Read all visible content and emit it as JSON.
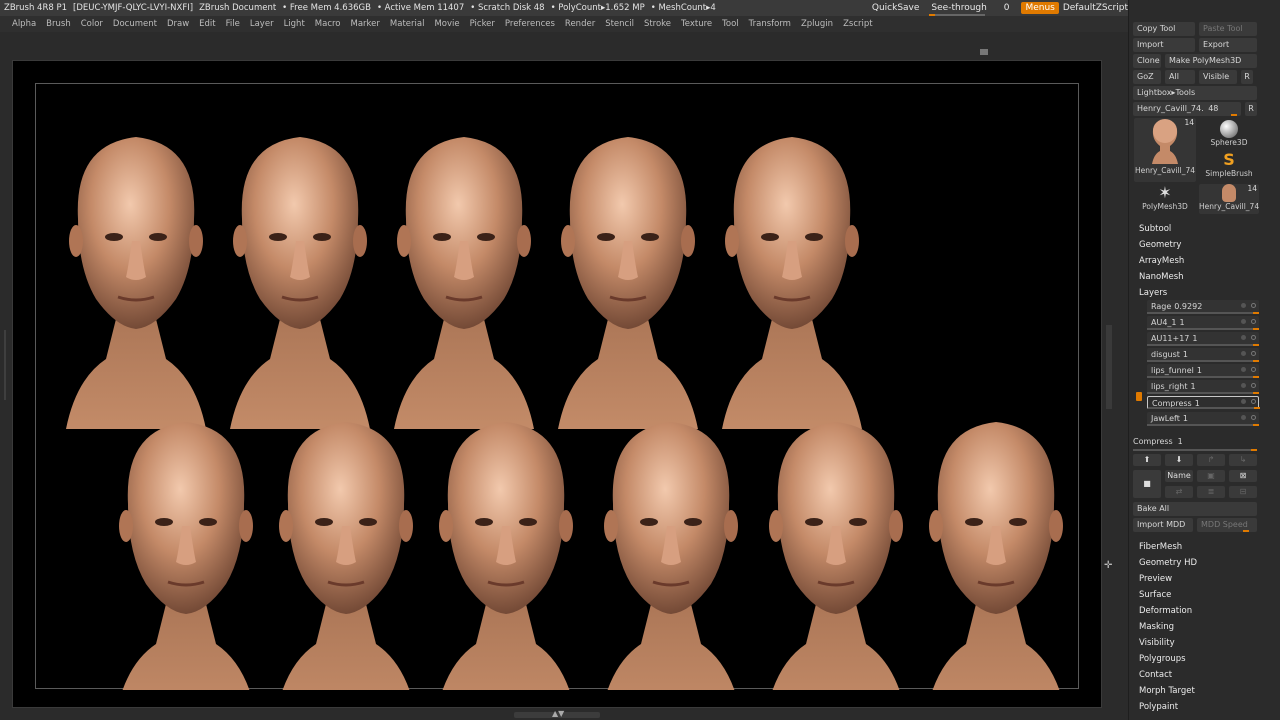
{
  "titlebar": {
    "app": "ZBrush 4R8 P1",
    "license": "[DEUC-YMJF-QLYC-LVYI-NXFI]",
    "document": "ZBrush Document",
    "free_mem": "• Free Mem 4.636GB",
    "active_mem": "• Active Mem 11407",
    "scratch": "• Scratch Disk 48",
    "polycount": "• PolyCount▸1.652 MP",
    "meshcount": "• MeshCount▸4",
    "quicksave": "QuickSave",
    "seethrough": "See-through",
    "seethrough_value": "0",
    "seethrough_level": 0.0,
    "menus": "Menus",
    "script": "DefaultZScript"
  },
  "menubar": {
    "items": [
      "Alpha",
      "Brush",
      "Color",
      "Document",
      "Draw",
      "Edit",
      "File",
      "Layer",
      "Light",
      "Macro",
      "Marker",
      "Material",
      "Movie",
      "Picker",
      "Preferences",
      "Render",
      "Stencil",
      "Stroke",
      "Texture",
      "Tool",
      "Transform",
      "Zplugin",
      "Zscript"
    ]
  },
  "tool_panel": {
    "copy_tool": "Copy Tool",
    "paste_tool": "Paste Tool",
    "import": "Import",
    "export": "Export",
    "clone": "Clone",
    "make_polymesh": "Make PolyMesh3D",
    "goz": "GoZ",
    "all": "All",
    "visible": "Visible",
    "r": "R",
    "lightbox": "Lightbox▸Tools",
    "current_tool": "Henry_Cavill_74.",
    "current_tool_value": "48",
    "tiles": [
      {
        "label": "Henry_Cavill_74",
        "count": "14"
      },
      {
        "label": "Sphere3D",
        "count": ""
      },
      {
        "label": "SimpleBrush",
        "count": ""
      },
      {
        "label": "PolyMesh3D",
        "count": ""
      },
      {
        "label": "Henry_Cavill_74",
        "count": "14"
      }
    ]
  },
  "sections_top": [
    "Subtool",
    "Geometry",
    "ArrayMesh",
    "NanoMesh"
  ],
  "layers": {
    "title": "Layers",
    "rows": [
      {
        "label": "Rage",
        "value": "0.9292"
      },
      {
        "label": "AU4_1",
        "value": "1"
      },
      {
        "label": "AU11+17",
        "value": "1"
      },
      {
        "label": "disgust",
        "value": "1"
      },
      {
        "label": "lips_funnel",
        "value": "1"
      },
      {
        "label": "lips_right",
        "value": "1"
      },
      {
        "label": "Compress",
        "value": "1"
      },
      {
        "label": "JawLeft",
        "value": "1"
      }
    ],
    "slider_label": "Compress",
    "slider_value": "1",
    "name_btn": "Name",
    "bake_all": "Bake All",
    "import_mdd": "Import MDD",
    "mdd_speed": "MDD Speed"
  },
  "sections_bottom": [
    "FiberMesh",
    "Geometry HD",
    "Preview",
    "Surface",
    "Deformation",
    "Masking",
    "Visibility",
    "Polygroups",
    "Contact",
    "Morph Target",
    "Polypaint"
  ],
  "colors": {
    "accent": "#e07a00",
    "skin": "#c48a68"
  }
}
